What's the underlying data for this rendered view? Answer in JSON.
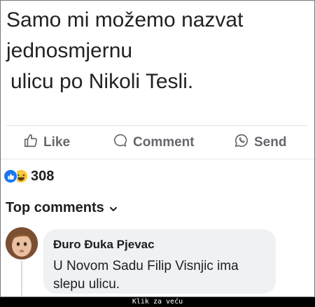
{
  "post": {
    "lines": [
      "Samo mi možemo nazvat",
      "jednosmjernu",
      "ulicu po Nikoli Tesli."
    ]
  },
  "actions": {
    "like": "Like",
    "comment": "Comment",
    "send": "Send"
  },
  "reactions": {
    "count": "308",
    "icons": [
      "like-reaction-icon",
      "haha-reaction-icon"
    ]
  },
  "comments_header": "Top comments",
  "comment": {
    "author": "Đuro Đuka Pjevac",
    "text": "U Novom Sadu Filip Visnjic ima slepu ulicu."
  },
  "footer": "Klik za veću",
  "colors": {
    "action_gray": "#65676b",
    "like_blue": "#1877f2",
    "haha_yellow": "#f7c93c",
    "bubble": "#eff1f3"
  }
}
